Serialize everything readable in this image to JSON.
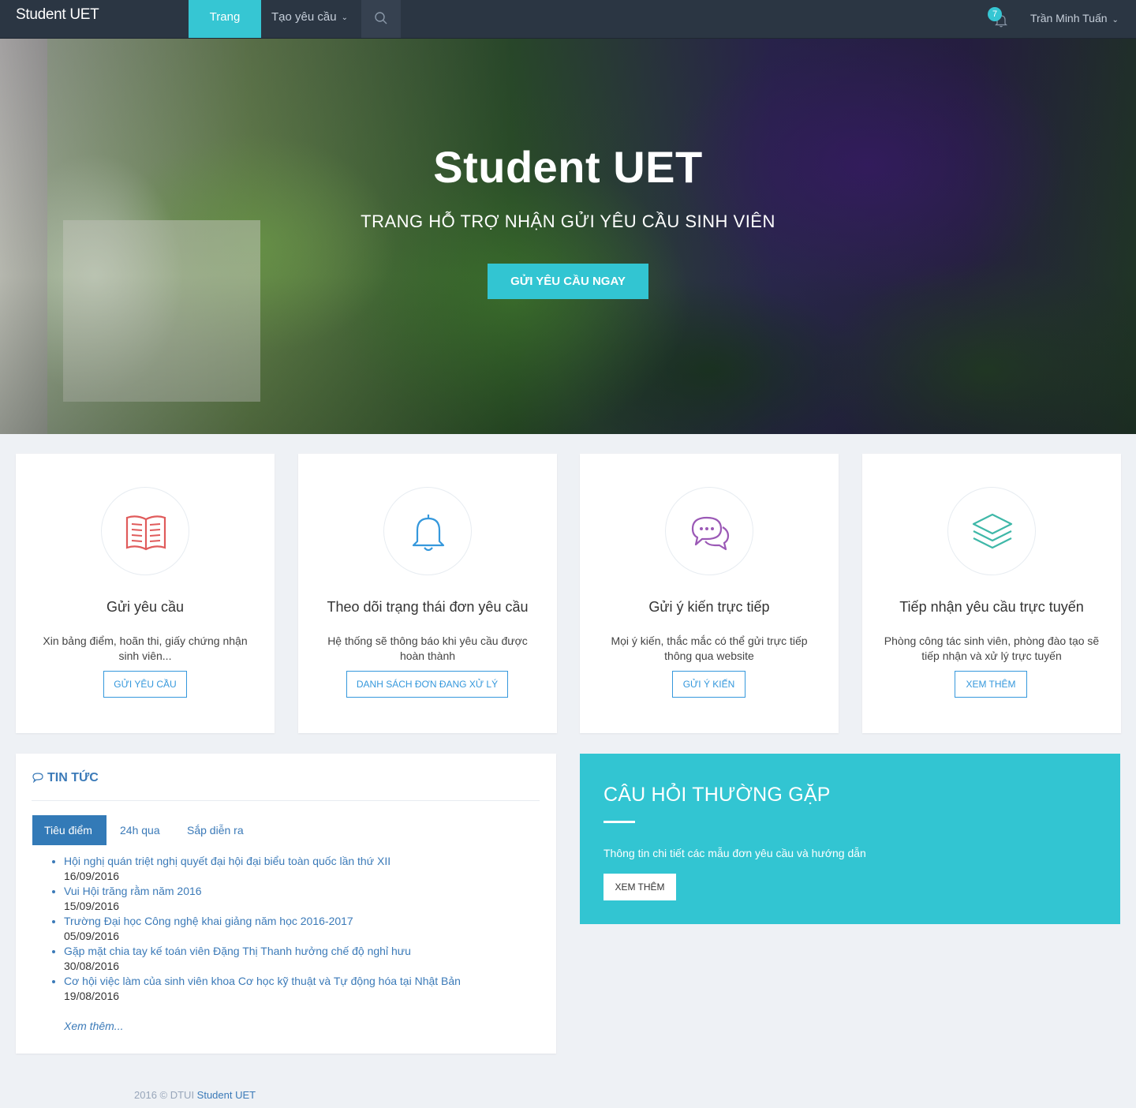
{
  "navbar": {
    "brand": "Student UET",
    "home": "Trang chủ",
    "create": "Tạo yêu cầu",
    "notifications_count": "7",
    "user_name": "Trần Minh Tuấn"
  },
  "hero": {
    "title": "Student UET",
    "subtitle": "TRANG HỖ TRỢ NHẬN GỬI YÊU CẦU SINH VIÊN",
    "cta": "GỬI YÊU CẦU NGAY"
  },
  "features": [
    {
      "icon": "book-icon",
      "title": "Gửi yêu cầu",
      "desc": "Xin bảng điểm, hoãn thi, giấy chứng nhận sinh viên...",
      "button": "GỬI YÊU CẦU"
    },
    {
      "icon": "bell-icon",
      "title": "Theo dõi trạng thái đơn yêu cầu",
      "desc": "Hệ thống sẽ thông báo khi yêu cầu được hoàn thành",
      "button": "DANH SÁCH ĐƠN ĐANG XỬ LÝ"
    },
    {
      "icon": "chat-icon",
      "title": "Gửi ý kiến trực tiếp",
      "desc": "Mọi ý kiến, thắc mắc có thể gửi trực tiếp thông qua website",
      "button": "GỬI Ý KIẾN"
    },
    {
      "icon": "layers-icon",
      "title": "Tiếp nhận yêu cầu trực tuyến",
      "desc": "Phòng công tác sinh viên, phòng đào tạo sẽ tiếp nhận và xử lý trực tuyến",
      "button": "XEM THÊM"
    }
  ],
  "news": {
    "heading": "TIN TỨC",
    "tabs": [
      "Tiêu điểm",
      "24h qua",
      "Sắp diễn ra"
    ],
    "items": [
      {
        "title": "Hội nghị quán triệt nghị quyết đại hội đại biểu toàn quốc lần thứ XII",
        "date": "16/09/2016"
      },
      {
        "title": "Vui Hội trăng rằm năm 2016",
        "date": "15/09/2016"
      },
      {
        "title": "Trường Đại học Công nghệ khai giảng năm học 2016-2017",
        "date": "05/09/2016"
      },
      {
        "title": "Gặp mặt chia tay kế toán viên Đặng Thị Thanh hưởng chế độ nghỉ hưu",
        "date": "30/08/2016"
      },
      {
        "title": "Cơ hội việc làm của sinh viên khoa Cơ học kỹ thuật và Tự động hóa tại Nhật Bản",
        "date": "19/08/2016"
      }
    ],
    "more": "Xem thêm..."
  },
  "faq": {
    "title": "CÂU HỎI THƯỜNG GẶP",
    "desc": "Thông tin chi tiết các mẫu đơn yêu cầu và hướng dẫn",
    "button": "XEM THÊM"
  },
  "footer": {
    "prefix": "2016 © DTUI ",
    "link": "Student UET"
  },
  "colors": {
    "accent": "#32c5d2",
    "navbar": "#2b3643",
    "primary": "#337ab7",
    "book_icon": "#e05b5b",
    "bell_icon": "#3598dc",
    "chat_icon": "#9b59b6",
    "layers_icon": "#3fb8a8"
  }
}
